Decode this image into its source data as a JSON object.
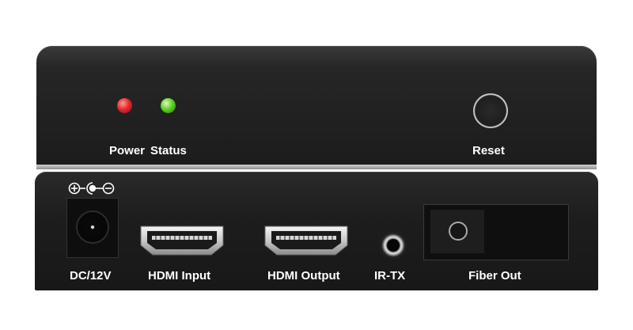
{
  "front_panel": {
    "indicators": [
      {
        "label": "Power",
        "color": "#e52b2b"
      },
      {
        "label": "Status",
        "color": "#5fd22a"
      }
    ],
    "reset_label": "Reset"
  },
  "rear_panel": {
    "polarity_symbol": "⊕-●-⊖",
    "ports": [
      {
        "label": "DC/12V",
        "icon": "dc-power-socket-icon"
      },
      {
        "label": "HDMI Input",
        "icon": "hdmi-port-icon"
      },
      {
        "label": "HDMI Output",
        "icon": "hdmi-port-icon"
      },
      {
        "label": "IR-TX",
        "icon": "audio-jack-icon"
      },
      {
        "label": "Fiber Out",
        "icon": "fiber-port-icon"
      }
    ]
  }
}
